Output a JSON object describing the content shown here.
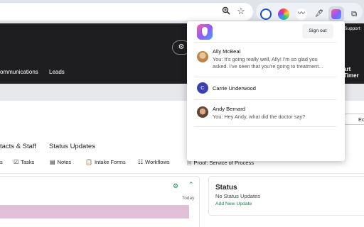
{
  "browser": {
    "toolbar_icons": [
      "zoom-icon",
      "bookmark-star-icon"
    ],
    "extensions": [
      "1password-icon",
      "color-ring-icon",
      "wave-icon",
      "pipette-icon",
      "app-extension-icon",
      "puzzle-icon"
    ]
  },
  "app": {
    "nav": [
      "ommunications",
      "Leads"
    ],
    "support_label": "Support",
    "start_timer_label": "art Timer",
    "edit_label": "Ed"
  },
  "page": {
    "subtabs": [
      "tacts & Staff",
      "Status Updates"
    ],
    "tools": [
      {
        "icon": "list-icon",
        "label": "s"
      },
      {
        "icon": "checkbox-icon",
        "label": "Tasks"
      },
      {
        "icon": "note-icon",
        "label": "Notes"
      },
      {
        "icon": "clipboard-icon",
        "label": "Intake Forms"
      },
      {
        "icon": "workflow-icon",
        "label": "Workflows"
      },
      {
        "icon": "document-icon",
        "label": "Proof: Service of Process"
      }
    ],
    "timeline": {
      "today_label": "Today"
    },
    "status_card": {
      "title": "Status",
      "empty_text": "No Status Updates",
      "add_label": "Add New Update"
    }
  },
  "popup": {
    "signout_label": "Sign out",
    "contacts": [
      {
        "name": "Ally McBeal",
        "message_line1": "You: It's going really well, Ally! I'm so glad you",
        "message_line2": "asked. I've seen that you're going to treatment...",
        "avatar": "photo"
      },
      {
        "name": "Carrie Underwood",
        "avatar_initial": "C",
        "avatar_color": "#3b3fb6"
      },
      {
        "name": "Andy Bernard",
        "message_line1": "You: Hey Andy, what did the doctor say?",
        "avatar": "photo"
      }
    ]
  }
}
